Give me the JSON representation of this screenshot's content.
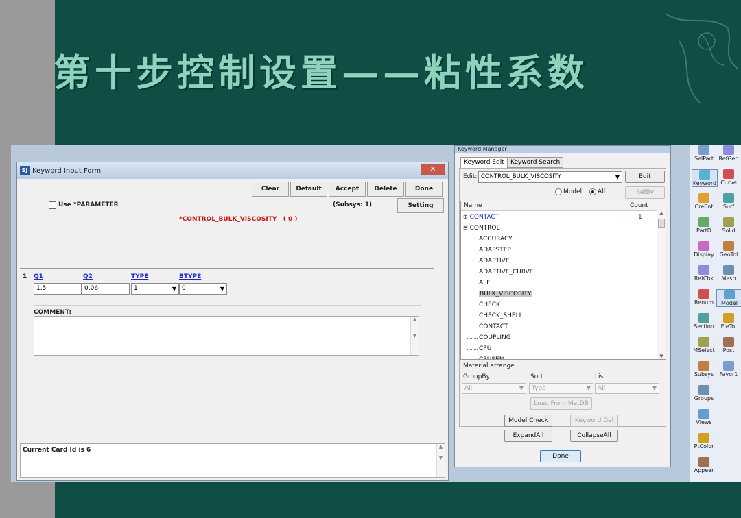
{
  "slide": {
    "title": "第十步控制设置——粘性系数"
  },
  "keyword_input_form": {
    "title": "Keyword Input Form",
    "buttons": [
      "Clear",
      "Default",
      "Accept",
      "Delete",
      "Done"
    ],
    "use_parameter_label": "Use *PARAMETER",
    "subsys_label": "(Subsys: 1)",
    "setting_button": "Setting",
    "keyword_title": "*CONTROL_BULK_VISCOSITY   ( 0 )",
    "card_number": "1",
    "columns": [
      "Q1",
      "Q2",
      "TYPE",
      "BTYPE"
    ],
    "values": {
      "q1": "1.5",
      "q2": "0.06",
      "type": "1",
      "btype": "0"
    },
    "comment_label": "COMMENT:",
    "status_text": "Current Card Id is 6"
  },
  "keyword_manager": {
    "title": "Keyword Manager",
    "tabs": [
      "Keyword Edit",
      "Keyword Search"
    ],
    "edit_label": "Edit:",
    "edit_value": "CONTROL_BULK_VISCOSITY",
    "edit_button": "Edit",
    "radio_model": "Model",
    "radio_all": "All",
    "refby_button": "RefBy",
    "col_name": "Name",
    "col_count": "Count",
    "tree_top": [
      {
        "label": "CONTACT",
        "count": "1"
      },
      {
        "label": "CONTROL",
        "count": ""
      }
    ],
    "tree_children": [
      "ACCURACY",
      "ADAPSTEP",
      "ADAPTIVE",
      "ADAPTIVE_CURVE",
      "ALE",
      "BULK_VISCOSITY",
      "CHECK",
      "CHECK_SHELL",
      "CONTACT",
      "COUPLING",
      "CPU",
      "CPUSEN"
    ],
    "material_arrange": "Material arrange",
    "groupby_label": "GroupBy",
    "sort_label": "Sort",
    "list_label": "List",
    "groupby_value": "All",
    "sort_value": "Type",
    "list_value": "All",
    "load_button": "Load From MatDB",
    "model_check": "Model Check",
    "keyword_del": "Keyword Del",
    "expand_all": "ExpandAll",
    "collapse_all": "CollapseAll",
    "done": "Done"
  },
  "toolbar": {
    "left": [
      "SelPart",
      "Keyword",
      "CreEnt",
      "PartD",
      "Display",
      "RefChk",
      "Renum",
      "Section",
      "MSelect",
      "Subsys",
      "Groups",
      "Views",
      "PtColor",
      "Appear"
    ],
    "right": [
      "RefGeo",
      "Curve",
      "Surf",
      "Solid",
      "GeoTol",
      "Mesh",
      "Model",
      "EleTol",
      "Post",
      "Favor1"
    ],
    "refchk_sub": "Renum"
  },
  "colors": {
    "slide_bg": "#0f4d45",
    "title_text": "#8fd3bf",
    "keyword_title_red": "#d01010",
    "link_blue": "#1a2ad0"
  }
}
